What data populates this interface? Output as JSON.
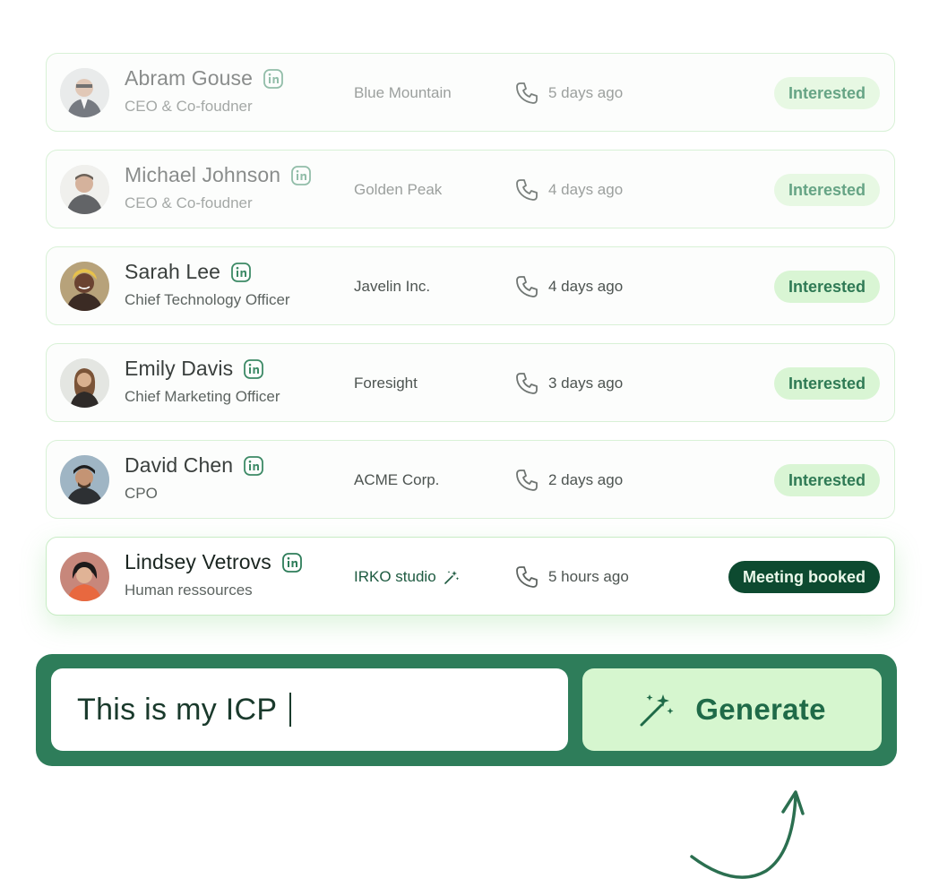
{
  "leads": [
    {
      "name": "Abram Gouse",
      "role": "CEO & Co-foudner",
      "company": "Blue Mountain",
      "last_contact": "5 days ago",
      "status": "Interested",
      "avatar_icon": "avatar-abram",
      "linkedin_icon": "linkedin-icon"
    },
    {
      "name": "Michael Johnson",
      "role": "CEO & Co-foudner",
      "company": "Golden Peak",
      "last_contact": "4 days ago",
      "status": "Interested",
      "avatar_icon": "avatar-michael",
      "linkedin_icon": "linkedin-icon"
    },
    {
      "name": "Sarah Lee",
      "role": "Chief Technology Officer",
      "company": "Javelin Inc.",
      "last_contact": "4 days ago",
      "status": "Interested",
      "avatar_icon": "avatar-sarah",
      "linkedin_icon": "linkedin-icon"
    },
    {
      "name": "Emily Davis",
      "role": "Chief Marketing Officer",
      "company": "Foresight",
      "last_contact": "3 days ago",
      "status": "Interested",
      "avatar_icon": "avatar-emily",
      "linkedin_icon": "linkedin-icon"
    },
    {
      "name": "David Chen",
      "role": "CPO",
      "company": "ACME Corp.",
      "last_contact": "2 days ago",
      "status": "Interested",
      "avatar_icon": "avatar-david",
      "linkedin_icon": "linkedin-icon"
    },
    {
      "name": "Lindsey Vetrovs",
      "role": "Human ressources",
      "company": "IRKO studio",
      "last_contact": "5 hours ago",
      "status": "Meeting booked",
      "avatar_icon": "avatar-lindsey",
      "linkedin_icon": "linkedin-icon"
    }
  ],
  "prompt": {
    "value": "This is my ICP",
    "generate_label": "Generate",
    "generate_icon": "magic-wand-icon"
  },
  "colors": {
    "primary_green": "#2e7d5a",
    "interested_bg": "#d9f5d4",
    "interested_text": "#2f7a55",
    "booked_bg": "#0d4a30",
    "generate_bg": "#d6f6cf",
    "row_border": "#d8f1d6"
  }
}
